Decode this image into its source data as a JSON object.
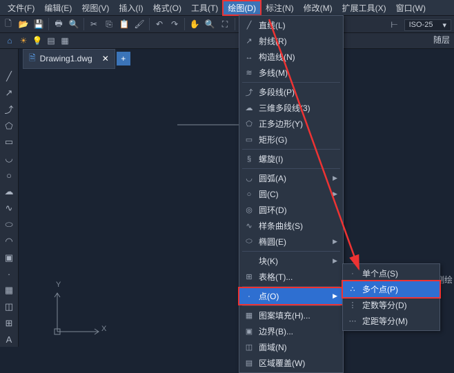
{
  "menubar": {
    "items": [
      "文件(F)",
      "编辑(E)",
      "视图(V)",
      "插入(I)",
      "格式(O)",
      "工具(T)",
      "绘图(D)",
      "标注(N)",
      "修改(M)",
      "扩展工具(X)",
      "窗口(W)"
    ],
    "active_index": 6
  },
  "iso_label": "ISO-25",
  "layer_label": "随层",
  "file_tab": {
    "name": "Drawing1.dwg"
  },
  "ucs": {
    "x": "X",
    "y": "Y"
  },
  "dropdown": {
    "items": [
      {
        "icon": "╱",
        "label": "直线(L)"
      },
      {
        "icon": "↗",
        "label": "射线(R)"
      },
      {
        "icon": "↔",
        "label": "构造线(N)"
      },
      {
        "icon": "≋",
        "label": "多线(M)"
      },
      {
        "sep": true
      },
      {
        "icon": "⤴",
        "label": "多段线(P)"
      },
      {
        "icon": "☁",
        "label": "三维多段线(3)"
      },
      {
        "icon": "⬠",
        "label": "正多边形(Y)"
      },
      {
        "icon": "▭",
        "label": "矩形(G)"
      },
      {
        "sep": true
      },
      {
        "icon": "§",
        "label": "螺旋(I)"
      },
      {
        "sep": true
      },
      {
        "icon": "◡",
        "label": "圆弧(A)",
        "sub": true
      },
      {
        "icon": "○",
        "label": "圆(C)",
        "sub": true
      },
      {
        "icon": "◎",
        "label": "圆环(D)"
      },
      {
        "icon": "∿",
        "label": "样条曲线(S)"
      },
      {
        "icon": "⬭",
        "label": "椭圆(E)",
        "sub": true
      },
      {
        "sep": true
      },
      {
        "icon": "",
        "label": "块(K)",
        "sub": true
      },
      {
        "icon": "⊞",
        "label": "表格(T)..."
      },
      {
        "sep": true
      },
      {
        "icon": "·",
        "label": "点(O)",
        "sub": true,
        "selected": true,
        "hl": true
      },
      {
        "sep": true
      },
      {
        "icon": "▦",
        "label": "图案填充(H)..."
      },
      {
        "icon": "▣",
        "label": "边界(B)..."
      },
      {
        "icon": "◫",
        "label": "面域(N)"
      },
      {
        "icon": "▤",
        "label": "区域覆盖(W)"
      }
    ]
  },
  "submenu": {
    "items": [
      {
        "icon": "·",
        "label": "单个点(S)"
      },
      {
        "icon": "∴",
        "label": "多个点(P)",
        "selected": true,
        "hl": true
      },
      {
        "icon": "⋮",
        "label": "定数等分(D)"
      },
      {
        "icon": "⋯",
        "label": "定距等分(M)"
      }
    ]
  },
  "watermark": "搜狐号@大水牛测绘"
}
